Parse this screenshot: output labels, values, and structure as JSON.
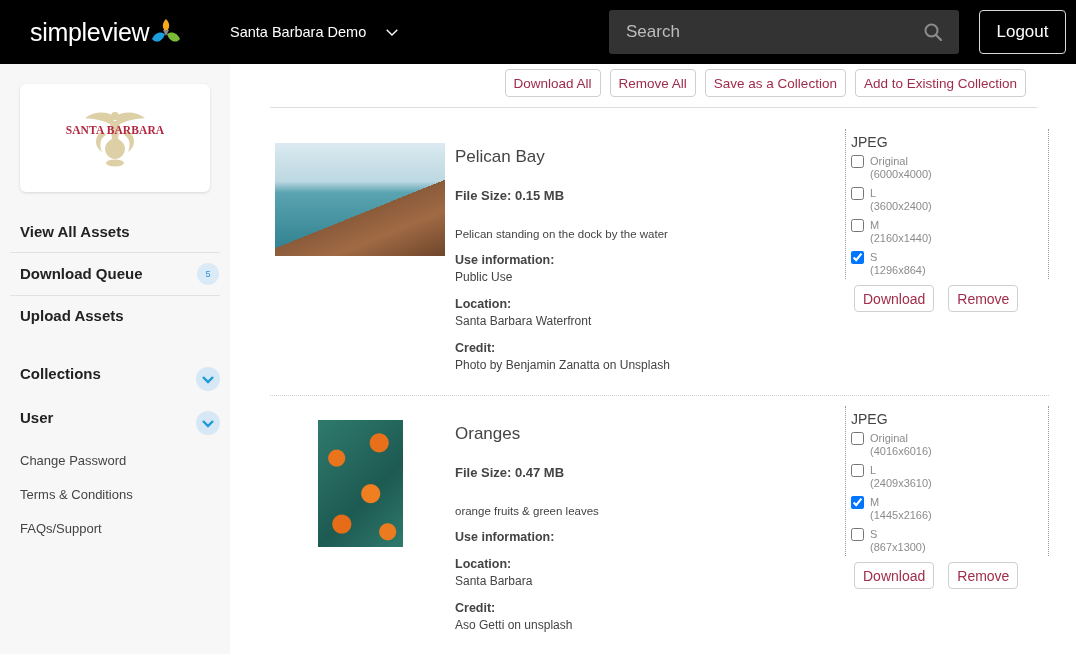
{
  "header": {
    "brand": "simpleview",
    "account": "Santa Barbara Demo",
    "search": {
      "placeholder": "Search"
    },
    "logout": "Logout"
  },
  "sidebar": {
    "logo_text": "SANTA BARBARA",
    "nav": [
      {
        "label": "View All Assets"
      },
      {
        "label": "Download Queue",
        "badge": "5"
      },
      {
        "label": "Upload Assets"
      }
    ],
    "sections": [
      {
        "label": "Collections",
        "expanded": false
      },
      {
        "label": "User",
        "expanded": false
      }
    ],
    "links": [
      "Change Password",
      "Terms & Conditions",
      "FAQs/Support"
    ]
  },
  "toolbar": {
    "buttons": [
      "Download All",
      "Remove All",
      "Save as a Collection",
      "Add to Existing Collection"
    ]
  },
  "assets": [
    {
      "kind": "landscape",
      "title": "Pelican Bay",
      "file_size": "File Size: 0.15 MB",
      "description": "Pelican standing on the dock by the water",
      "fields": [
        {
          "label": "Use information:",
          "value": "Public Use"
        },
        {
          "label": "Location:",
          "value": "Santa Barbara Waterfront"
        },
        {
          "label": "Credit:",
          "value": "Photo by Benjamin Zanatta on Unsplash"
        }
      ],
      "format": "JPEG",
      "sizes": [
        {
          "name": "Original",
          "dimensions": "(6000x4000)",
          "checked": false
        },
        {
          "name": "L",
          "dimensions": "(3600x2400)",
          "checked": false
        },
        {
          "name": "M",
          "dimensions": "(2160x1440)",
          "checked": false
        },
        {
          "name": "S",
          "dimensions": "(1296x864)",
          "checked": true
        }
      ],
      "buttons": [
        "Download",
        "Remove"
      ]
    },
    {
      "kind": "portrait",
      "title": "Oranges",
      "file_size": "File Size: 0.47 MB",
      "description": "orange fruits & green leaves",
      "fields": [
        {
          "label": "Use information:"
        },
        {
          "label": "Location:",
          "value": "Santa Barbara"
        },
        {
          "label": "Credit:",
          "value": "Aso Getti on unsplash"
        }
      ],
      "format": "JPEG",
      "sizes": [
        {
          "name": "Original",
          "dimensions": "(4016x6016)",
          "checked": false
        },
        {
          "name": "L",
          "dimensions": "(2409x3610)",
          "checked": false
        },
        {
          "name": "M",
          "dimensions": "(1445x2166)",
          "checked": true
        },
        {
          "name": "S",
          "dimensions": "(867x1300)",
          "checked": false
        }
      ],
      "buttons": [
        "Download",
        "Remove"
      ]
    }
  ]
}
